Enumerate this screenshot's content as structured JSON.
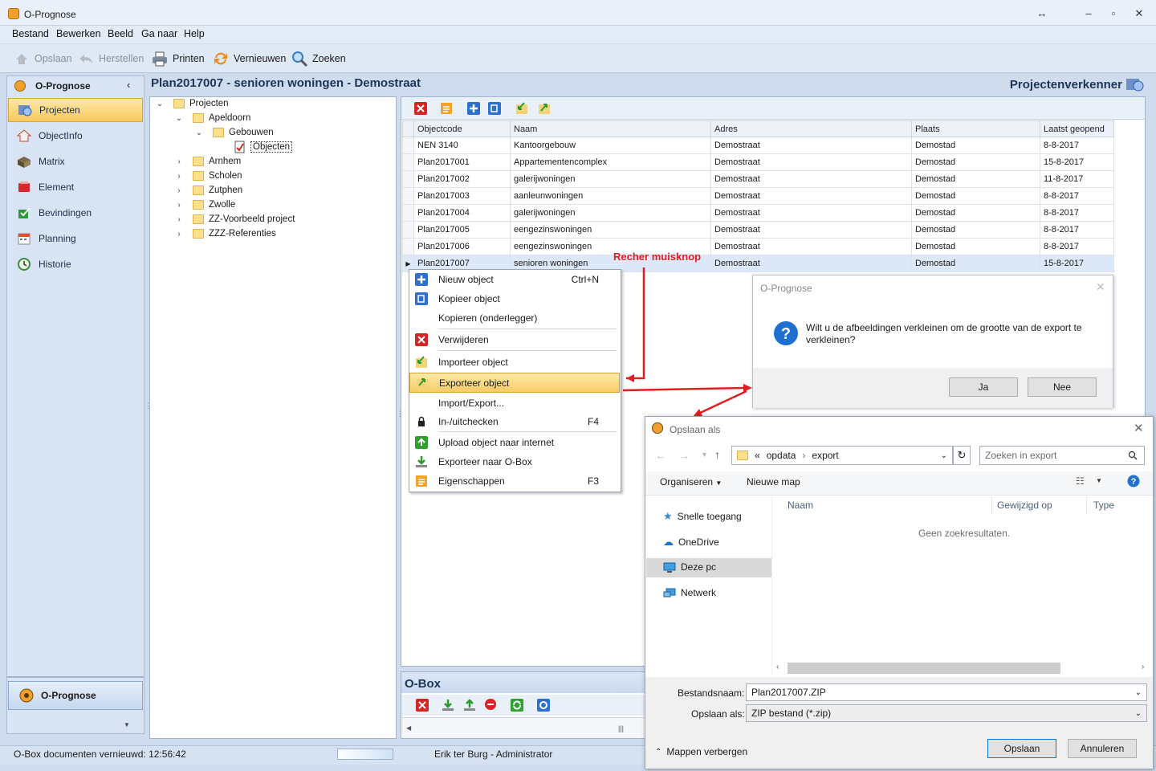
{
  "window": {
    "title": "O-Prognose"
  },
  "menu": [
    "Bestand",
    "Bewerken",
    "Beeld",
    "Ga naar",
    "Help"
  ],
  "toolbar": {
    "save": "Opslaan",
    "restore": "Herstellen",
    "print": "Printen",
    "refresh": "Vernieuwen",
    "search": "Zoeken"
  },
  "sidebar": {
    "header": "O-Prognose",
    "items": [
      {
        "label": "Projecten",
        "icon": "projects-icon"
      },
      {
        "label": "ObjectInfo",
        "icon": "house-icon"
      },
      {
        "label": "Matrix",
        "icon": "matrix-icon"
      },
      {
        "label": "Element",
        "icon": "element-icon"
      },
      {
        "label": "Bevindingen",
        "icon": "findings-icon"
      },
      {
        "label": "Planning",
        "icon": "planning-icon"
      },
      {
        "label": "Historie",
        "icon": "history-icon"
      }
    ],
    "bottom": "O-Prognose"
  },
  "heading": "Plan2017007 - senioren woningen - Demostraat",
  "explorer_title": "Projectenverkenner",
  "tree": [
    {
      "label": "Projecten",
      "level": 0,
      "expanded": true
    },
    {
      "label": "Apeldoorn",
      "level": 1,
      "expanded": true
    },
    {
      "label": "Gebouwen",
      "level": 2,
      "expanded": true
    },
    {
      "label": "Objecten",
      "level": 3,
      "selected": true
    },
    {
      "label": "Arnhem",
      "level": 1
    },
    {
      "label": "Scholen",
      "level": 1
    },
    {
      "label": "Zutphen",
      "level": 1
    },
    {
      "label": "Zwolle",
      "level": 1
    },
    {
      "label": "ZZ-Voorbeeld project",
      "level": 1
    },
    {
      "label": "ZZZ-Referenties",
      "level": 1
    }
  ],
  "grid": {
    "columns": [
      "Objectcode",
      "Naam",
      "Adres",
      "Plaats",
      "Laatst geopend"
    ],
    "rows": [
      [
        "NEN 3140",
        "Kantoorgebouw",
        "Demostraat",
        "Demostad",
        "8-8-2017"
      ],
      [
        "Plan2017001",
        "Appartementencomplex",
        "Demostraat",
        "Demostad",
        "15-8-2017"
      ],
      [
        "Plan2017002",
        "galerijwoningen",
        "Demostraat",
        "Demostad",
        "11-8-2017"
      ],
      [
        "Plan2017003",
        "aanleunwoningen",
        "Demostraat",
        "Demostad",
        "8-8-2017"
      ],
      [
        "Plan2017004",
        "galerijwoningen",
        "Demostraat",
        "Demostad",
        "8-8-2017"
      ],
      [
        "Plan2017005",
        "eengezinswoningen",
        "Demostraat",
        "Demostad",
        "8-8-2017"
      ],
      [
        "Plan2017006",
        "eengezinswoningen",
        "Demostraat",
        "Demostad",
        "8-8-2017"
      ],
      [
        "Plan2017007",
        "senioren woningen",
        "Demostraat",
        "Demostad",
        "15-8-2017"
      ]
    ]
  },
  "annotation": "Recher muisknop",
  "context_menu": [
    {
      "label": "Nieuw object",
      "shortcut": "Ctrl+N",
      "icon": "plus-icon"
    },
    {
      "label": "Kopieer object",
      "shortcut": "",
      "icon": "copy-icon"
    },
    {
      "label": "Kopieren (onderlegger)",
      "shortcut": "",
      "icon": ""
    },
    {
      "label": "Verwijderen",
      "shortcut": "",
      "icon": "delete-icon"
    },
    {
      "label": "Importeer object",
      "shortcut": "",
      "icon": "import-icon"
    },
    {
      "label": "Exporteer object",
      "shortcut": "",
      "icon": "export-icon"
    },
    {
      "label": "Import/Export...",
      "shortcut": "",
      "icon": ""
    },
    {
      "label": "In-/uitchecken",
      "shortcut": "F4",
      "icon": "lock-icon"
    },
    {
      "label": "Upload object naar internet",
      "shortcut": "",
      "icon": "upload-icon"
    },
    {
      "label": "Exporteer naar O-Box",
      "shortcut": "",
      "icon": "download-icon"
    },
    {
      "label": "Eigenschappen",
      "shortcut": "F3",
      "icon": "properties-icon"
    }
  ],
  "dialog": {
    "title": "O-Prognose",
    "message_line1": "Wilt u de afbeeldingen verkleinen om de grootte van de export te",
    "message_line2": "verkleinen?",
    "yes": "Ja",
    "no": "Nee"
  },
  "save_dialog": {
    "title": "Opslaan als",
    "path": [
      "opdata",
      "export"
    ],
    "path_prefix": "«",
    "search_placeholder": "Zoeken in export",
    "organize": "Organiseren",
    "new_folder": "Nieuwe map",
    "nav": [
      "Snelle toegang",
      "OneDrive",
      "Deze pc",
      "Netwerk"
    ],
    "columns": [
      "Naam",
      "Gewijzigd op",
      "Type"
    ],
    "empty": "Geen zoekresultaten.",
    "filename_label": "Bestandsnaam:",
    "filename": "Plan2017007.ZIP",
    "type_label": "Opslaan als:",
    "type": "ZIP bestand (*.zip)",
    "hide_folders": "Mappen verbergen",
    "save": "Opslaan",
    "cancel": "Annuleren"
  },
  "obox": {
    "title": "O-Box"
  },
  "status": {
    "left": "O-Box documenten vernieuwd: 12:56:42",
    "user": "Erik ter Burg - Administrator"
  }
}
